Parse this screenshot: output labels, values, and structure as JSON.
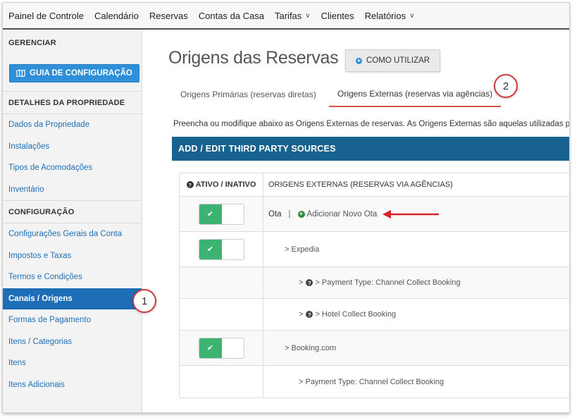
{
  "topnav": {
    "items": [
      {
        "label": "Painel de Controle",
        "dropdown": false
      },
      {
        "label": "Calendário",
        "dropdown": false
      },
      {
        "label": "Reservas",
        "dropdown": false
      },
      {
        "label": "Contas da Casa",
        "dropdown": false
      },
      {
        "label": "Tarifas",
        "dropdown": true
      },
      {
        "label": "Clientes",
        "dropdown": false
      },
      {
        "label": "Relatórios",
        "dropdown": true
      }
    ],
    "chevron_icon": "chevron-down-icon"
  },
  "sidebar": {
    "header_manage": "GERENCIAR",
    "guide_button": "GUIA DE CONFIGURAÇÃO",
    "guide_icon": "map-icon",
    "header_property": "DETALHES DA PROPRIEDADE",
    "property_items": [
      "Dados da Propriedade",
      "Instalações",
      "Tipos de Acomodações",
      "Inventário"
    ],
    "header_config": "CONFIGURAÇÃO",
    "config_items": [
      "Configurações Gerais da Conta",
      "Impostos e Taxas",
      "Termos e Condições",
      "Canais / Origens",
      "Formas de Pagamento",
      "Itens / Categorias",
      "Itens",
      "Itens Adicionais"
    ],
    "active_item": "Canais / Origens",
    "active_color": "#1e6db7"
  },
  "main": {
    "title": "Origens das Reservas",
    "how_button": "COMO UTILIZAR",
    "tabs": [
      {
        "label": "Origens Primárias (reservas diretas)",
        "active": false
      },
      {
        "label": "Origens Externas (reservas via agências)",
        "active": true
      }
    ],
    "description": "Preencha ou modifique abaixo as Origens Externas de reservas. As Origens Externas são aquelas utilizadas para",
    "panel_title": "ADD / EDIT THIRD PARTY SOURCES",
    "table": {
      "col1": "ATIVO / INATIVO",
      "col2": "ORIGENS EXTERNAS (RESERVAS VIA AGÊNCIAS)",
      "ota_label": "Ota",
      "separator": "|",
      "add_link": "Adicionar Novo Ota",
      "rows": [
        {
          "text": "> Expedia",
          "toggle": true
        },
        {
          "text": "> Payment Type: Channel Collect Booking",
          "help": true
        },
        {
          "text": "> Hotel Collect Booking",
          "help": true
        },
        {
          "text": "> Booking.com",
          "toggle": true
        },
        {
          "text": "> Payment Type: Channel Collect Booking",
          "help": false
        }
      ],
      "toggle_color": "#3cb371"
    }
  },
  "callouts": [
    "1",
    "2"
  ],
  "colors": {
    "panel": "#17628f",
    "guide_button": "#2f8fd8",
    "tab_underline": "#d9534f",
    "arrow": "#d9232a"
  }
}
